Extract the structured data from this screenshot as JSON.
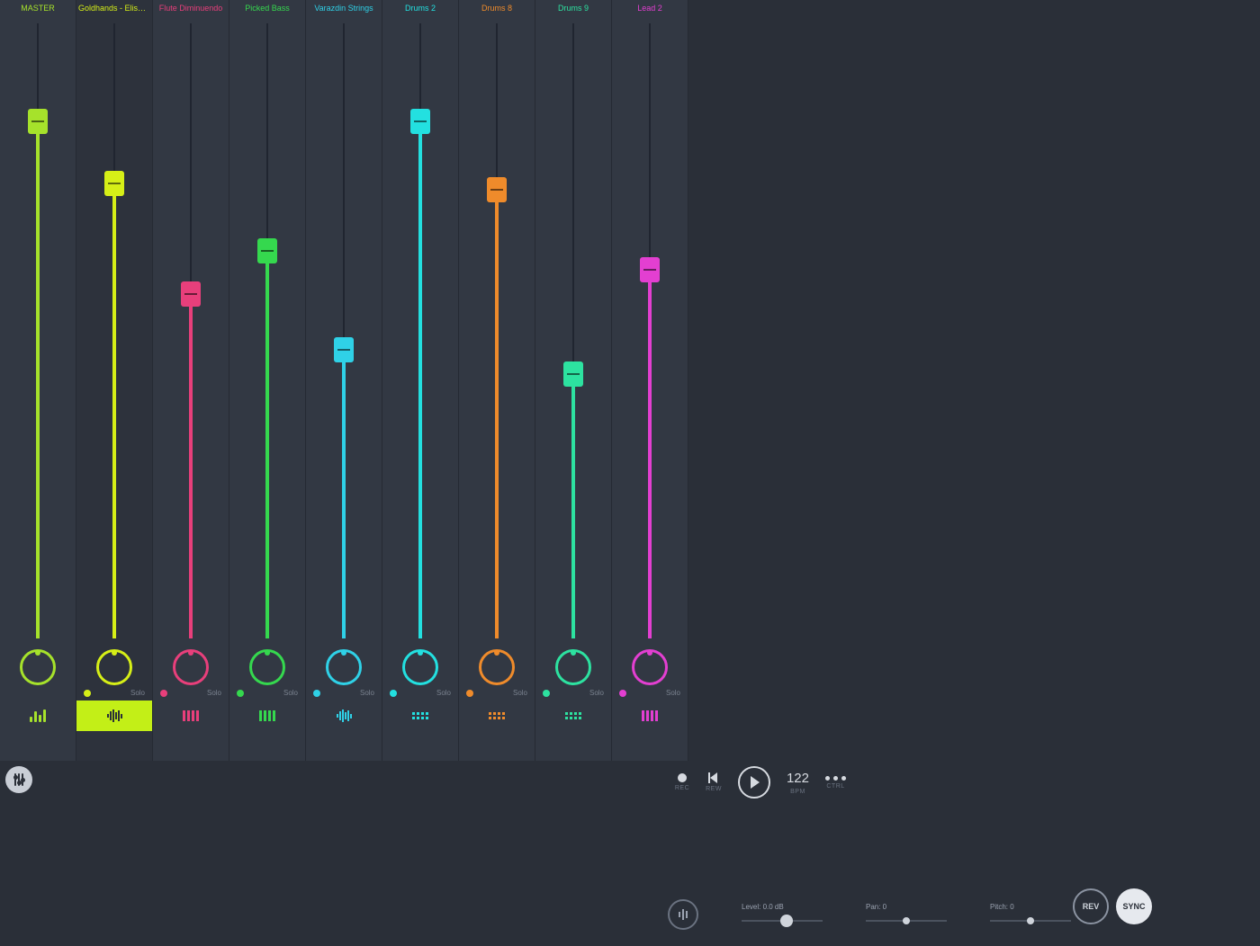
{
  "channels": [
    {
      "name": "MASTER",
      "color": "#a6e22b",
      "fader": 0.84,
      "solo": "",
      "selected": false,
      "icon": "bars"
    },
    {
      "name": "Goldhands - Elisa (...ocal)",
      "color": "#d6ef17",
      "fader": 0.74,
      "solo": "Solo",
      "selected": true,
      "icon": "wave"
    },
    {
      "name": "Flute Diminuendo",
      "color": "#e83f7b",
      "fader": 0.56,
      "solo": "Solo",
      "selected": false,
      "icon": "keys"
    },
    {
      "name": "Picked Bass",
      "color": "#35d84e",
      "fader": 0.63,
      "solo": "Solo",
      "selected": false,
      "icon": "keys"
    },
    {
      "name": "Varazdin Strings",
      "color": "#2fd1e7",
      "fader": 0.47,
      "solo": "Solo",
      "selected": false,
      "icon": "wave"
    },
    {
      "name": "Drums 2",
      "color": "#23e0e0",
      "fader": 0.84,
      "solo": "Solo",
      "selected": false,
      "icon": "pads"
    },
    {
      "name": "Drums 8",
      "color": "#ef8b2b",
      "fader": 0.73,
      "solo": "Solo",
      "selected": false,
      "icon": "pads"
    },
    {
      "name": "Drums 9",
      "color": "#2de2a0",
      "fader": 0.43,
      "solo": "Solo",
      "selected": false,
      "icon": "pads"
    },
    {
      "name": "Lead 2",
      "color": "#e33fd1",
      "fader": 0.6,
      "solo": "Solo",
      "selected": false,
      "icon": "keys"
    }
  ],
  "transport": {
    "rec": "REC",
    "rew": "REW",
    "bpm_value": "122",
    "bpm_label": "BPM",
    "ctrl": "CTRL"
  },
  "params": {
    "level_label": "Level: 0.0 dB",
    "level_pos": 0.55,
    "pan_label": "Pan: 0",
    "pan_pos": 0.5,
    "pitch_label": "Pitch: 0",
    "pitch_pos": 0.5
  },
  "buttons": {
    "rev": "REV",
    "sync": "SYNC"
  }
}
